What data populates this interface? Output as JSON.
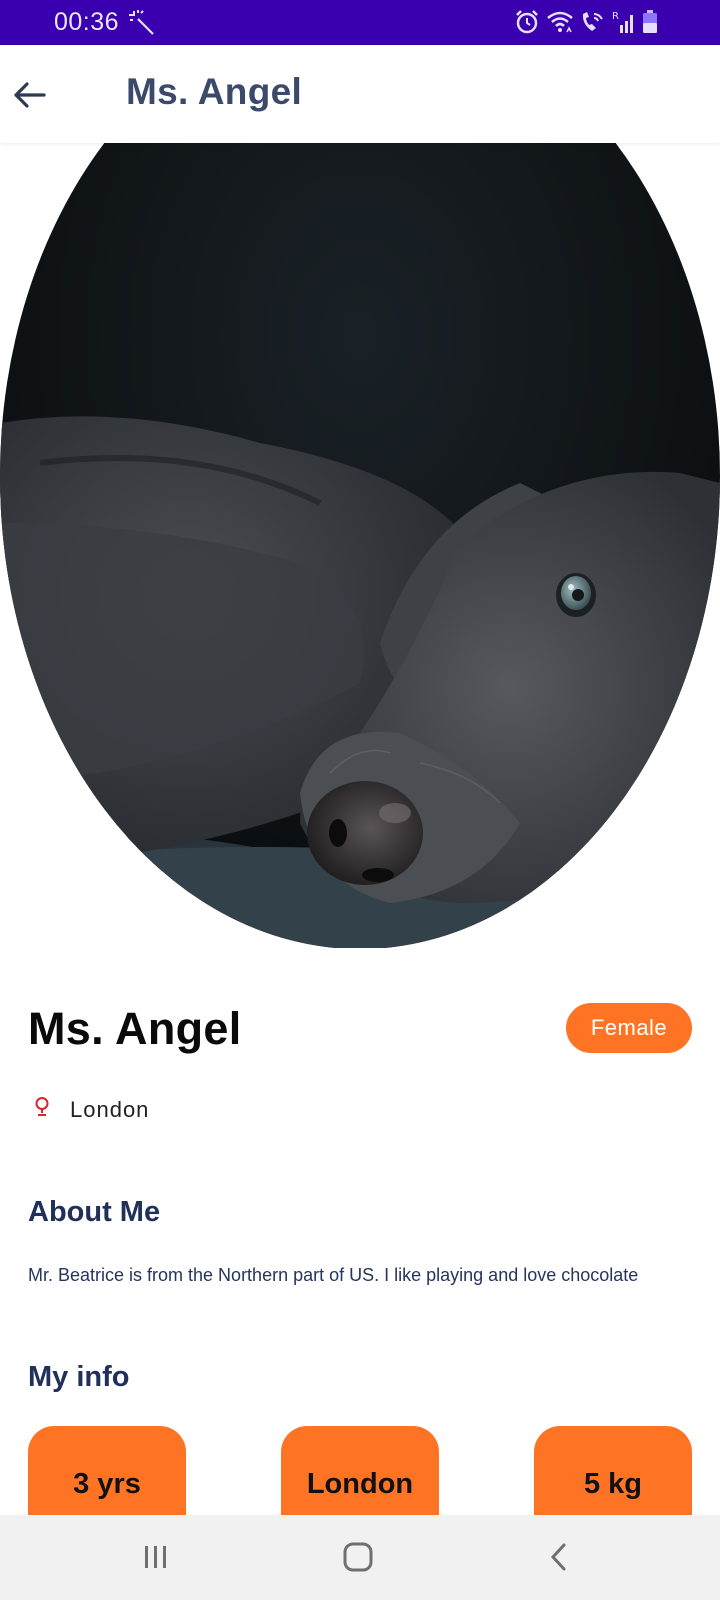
{
  "status_bar": {
    "time": "00:36",
    "icons": [
      "magic-wand-icon",
      "alarm-icon",
      "wifi-icon",
      "wifi-call-icon",
      "signal-icon",
      "battery-icon"
    ]
  },
  "app_bar": {
    "title": "Ms. Angel",
    "back_icon": "arrow-left-icon"
  },
  "hero_image": {
    "subject": "grey weimaraner dog lying on dark carpet"
  },
  "profile": {
    "name": "Ms. Angel",
    "gender": "Female",
    "location": "London",
    "location_icon": "location-pin-icon"
  },
  "about": {
    "title": "About Me",
    "text": "Mr. Beatrice is from the Northern part of US. I like playing and love chocolate"
  },
  "info": {
    "title": "My info",
    "cards": [
      {
        "value": "3 yrs"
      },
      {
        "value": "London"
      },
      {
        "value": "5 kg"
      }
    ]
  },
  "colors": {
    "status_bar": "#3a00b0",
    "accent": "#fe7424",
    "heading": "#20305a",
    "app_title": "#3b4a6b",
    "nav_bar": "#f1f1f1"
  },
  "nav_bar": {
    "buttons": [
      "recents-icon",
      "home-icon",
      "back-icon"
    ]
  }
}
